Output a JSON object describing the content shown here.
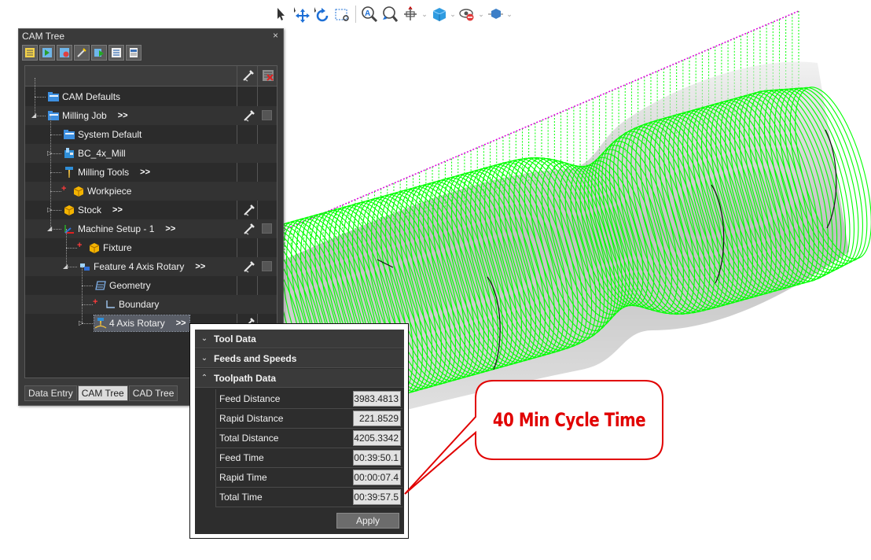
{
  "cam_tree": {
    "title": "CAM Tree",
    "close_glyph": "×",
    "header_icons": [
      "visibility-icon",
      "delete-icon"
    ],
    "items": [
      {
        "label": "CAM Defaults",
        "icon": "folder-icon"
      },
      {
        "label": "Milling Job",
        "icon": "folder-icon",
        "more": ">>"
      },
      {
        "label": "System Default",
        "icon": "folder-icon"
      },
      {
        "label": "BC_4x_Mill",
        "icon": "machine-icon"
      },
      {
        "label": "Milling Tools",
        "icon": "tool-icon",
        "more": ">>"
      },
      {
        "label": "Workpiece",
        "icon": "cube-icon"
      },
      {
        "label": "Stock",
        "icon": "cube-icon",
        "more": ">>"
      },
      {
        "label": "Machine Setup - 1",
        "icon": "axes-icon",
        "more": ">>"
      },
      {
        "label": "Fixture",
        "icon": "cube-icon"
      },
      {
        "label": "Feature 4 Axis Rotary",
        "icon": "feature-icon",
        "more": ">>"
      },
      {
        "label": "Geometry",
        "icon": "geometry-icon"
      },
      {
        "label": "Boundary",
        "icon": "boundary-icon"
      },
      {
        "label": "4 Axis Rotary",
        "icon": "toolpath-icon",
        "more": ">>"
      }
    ],
    "tabs": [
      "Data Entry",
      "CAM Tree",
      "CAD Tree"
    ],
    "active_tab": "CAM Tree"
  },
  "toolpath_panel": {
    "sections": [
      {
        "label": "Tool Data",
        "state": "collapsed"
      },
      {
        "label": "Feeds and Speeds",
        "state": "collapsed"
      },
      {
        "label": "Toolpath Data",
        "state": "expanded"
      }
    ],
    "rows": [
      {
        "label": "Feed Distance",
        "value": "3983.4813"
      },
      {
        "label": "Rapid Distance",
        "value": "221.8529"
      },
      {
        "label": "Total Distance",
        "value": "4205.3342"
      },
      {
        "label": "Feed Time",
        "value": "00:39:50.1"
      },
      {
        "label": "Rapid Time",
        "value": "00:00:07.4"
      },
      {
        "label": "Total Time",
        "value": "00:39:57.5"
      }
    ],
    "apply_label": "Apply"
  },
  "callout": {
    "text": "40 Min Cycle Time",
    "color": "#e10000"
  },
  "colors": {
    "toolpath_green": "#00ff00",
    "rapid_magenta": "#dd00dd",
    "panel_dark": "#2b2b2b"
  },
  "toolbar": {
    "icons": [
      "select-arrow-icon",
      "pan-icon",
      "rotate-icon",
      "zoom-box-icon",
      "zoom-fit-icon",
      "zoom-icon",
      "plane-icon",
      "view-cube-icon",
      "visibility-icon",
      "shading-icon"
    ]
  }
}
